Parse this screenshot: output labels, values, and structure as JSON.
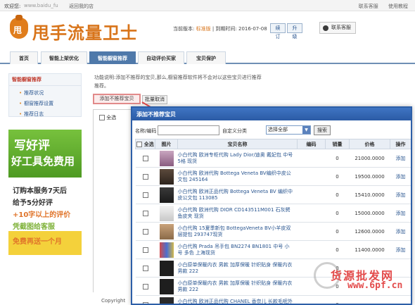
{
  "topbar": {
    "welcome": "欢迎您:",
    "user": "www.baidu_fu",
    "shop": "返回我的店",
    "contact": "联系客服",
    "help": "使用教程"
  },
  "header": {
    "logo_char": "甩",
    "logo_text": "甩手流量卫士",
    "version_label": "当前版本:",
    "version_value": "标准版",
    "expire_label": "到期时间:",
    "expire_value": "2016-07-08",
    "renew": "续订",
    "upgrade": "升级",
    "contact": "联系客服"
  },
  "nav": {
    "tabs": [
      "首页",
      "智能上架优化",
      "智能橱窗推荐",
      "自动评价买家",
      "宝贝保护"
    ],
    "active_index": 2
  },
  "sidebar": {
    "title": "智能橱窗推荐",
    "items": [
      "推荐状况",
      "橱窗推荐设置",
      "推荐日志"
    ]
  },
  "ad": {
    "line1": "写好评",
    "line2": "好工具免费用",
    "line3": "订购本服务7天后",
    "line4": "给予5分好评",
    "line5": "+10字以上的评价",
    "line6": "凭截图给客服",
    "line7": "免费再送一个月"
  },
  "content": {
    "note1": "功能说明:添加不推荐的宝贝,那么,橱窗推荐软件将不会对以这些宝贝进行推荐",
    "note2": "推荐。",
    "add_button": "添加不推荐宝贝",
    "cancel_button": "批量取消",
    "bg_header": "全选",
    "copyright": "Copyright"
  },
  "modal": {
    "title": "添加不推荐宝贝",
    "name_label": "名称/编码",
    "name_value": "",
    "category_label": "自定义分类",
    "category_selected": "选择全部",
    "search_button": "搜索",
    "headers": [
      "全选",
      "图片",
      "宝贝名称",
      "编码",
      "销量",
      "价格",
      "操作"
    ],
    "rows": [
      {
        "name": "小白代购 欧洲专柜代购 Lady Dior/迪奥 戴妃包 中号 5格 现货",
        "code": "",
        "sold": "0",
        "price": "21000.0000",
        "op": "添加"
      },
      {
        "name": "小白代购 欧洲代购 Bottega Veneta BV编织中皮公文包 245164",
        "code": "",
        "sold": "0",
        "price": "19500.0000",
        "op": "添加"
      },
      {
        "name": "小白代购 欧洲正品代购 Bottega Veneta BV 编织中皮公文包 113085",
        "code": "",
        "sold": "0",
        "price": "15410.0000",
        "op": "添加"
      },
      {
        "name": "小白代购 欧洲代购 DIOR CD143511M001 石灰鳄鱼皮夹 现货",
        "code": "",
        "sold": "0",
        "price": "15000.0000",
        "op": "添加"
      },
      {
        "name": "小白代购 15夏季新包 BottegaVeneta BV小羊皮双层提包 293747现货",
        "code": "",
        "sold": "0",
        "price": "12600.0000",
        "op": "添加"
      },
      {
        "name": "小白代购 Prada 吊手包 BN2274 BN1801 中号 小号 多色 上海现货",
        "code": "",
        "sold": "0",
        "price": "11400.0000",
        "op": "添加"
      },
      {
        "name": "小白原单保暖内衣 男款 加厚保暖 针织贴身 保暖内衣男款 222",
        "code": "",
        "sold": "0",
        "price": "",
        "op": ""
      },
      {
        "name": "小白原单保暖内衣 男款 加厚保暖 针织贴身 保暖内衣男款 222",
        "code": "",
        "sold": "0",
        "price": "",
        "op": ""
      },
      {
        "name": "小白代购 欧洲正品代购 CHANEL 香奈儿 长款毛呢外套 上海现货",
        "code": "",
        "sold": "0",
        "price": "",
        "op": ""
      }
    ]
  },
  "watermark": {
    "line1": "货源批发网",
    "line2": "www.6pf.cn"
  },
  "colors": {
    "brand": "#d8741a",
    "nav_active": "#4f79aa",
    "modal_title": "#2d5fa8",
    "link": "#2a5690"
  }
}
